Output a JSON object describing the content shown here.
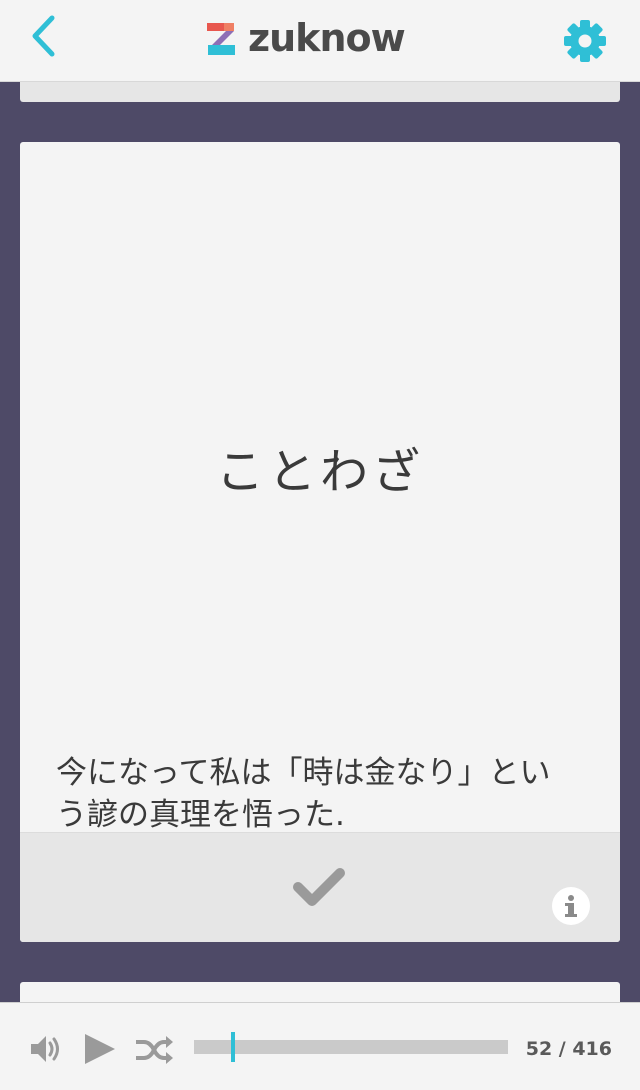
{
  "header": {
    "back_icon": "chevron-left-icon",
    "logo_text": "zuknow",
    "settings_icon": "gear-icon",
    "accent_color": "#2fbfd6"
  },
  "card": {
    "word": "ことわざ",
    "example": "今になって私は「時は金なり」という諺の真理を悟った.",
    "check_icon": "checkmark-icon",
    "info_icon": "info-icon"
  },
  "player": {
    "volume_icon": "speaker-icon",
    "play_icon": "play-icon",
    "shuffle_icon": "shuffle-icon",
    "current": 52,
    "total": 416,
    "counter_text": "52 / 416"
  }
}
